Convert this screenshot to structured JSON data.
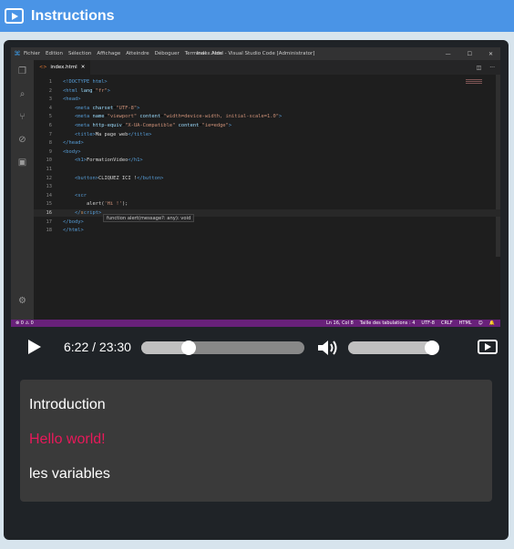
{
  "header": {
    "title": "Instructions",
    "icon": "video-icon"
  },
  "vscode": {
    "menu": [
      "Fichier",
      "Edition",
      "Sélection",
      "Affichage",
      "Atteindre",
      "Déboguer",
      "Terminal",
      "Aide"
    ],
    "window_title": "index.html - Visual Studio Code [Administrator]",
    "tab": "index.html",
    "code": [
      {
        "n": "1",
        "html": "<span class=\"c-tag\">&lt;!DOCTYPE html&gt;</span>"
      },
      {
        "n": "2",
        "html": "<span class=\"c-tag\">&lt;html</span> <span class=\"c-attr\">lang</span>=<span class=\"c-str\">\"fr\"</span><span class=\"c-tag\">&gt;</span>"
      },
      {
        "n": "3",
        "html": "<span class=\"c-tag\">&lt;head&gt;</span>"
      },
      {
        "n": "4",
        "html": "    <span class=\"c-tag\">&lt;meta</span> <span class=\"c-attr\">charset</span>=<span class=\"c-str\">\"UTF-8\"</span><span class=\"c-tag\">&gt;</span>"
      },
      {
        "n": "5",
        "html": "    <span class=\"c-tag\">&lt;meta</span> <span class=\"c-attr\">name</span>=<span class=\"c-str\">\"viewport\"</span> <span class=\"c-attr\">content</span>=<span class=\"c-str\">\"width=device-width, initial-scale=1.0\"</span><span class=\"c-tag\">&gt;</span>"
      },
      {
        "n": "6",
        "html": "    <span class=\"c-tag\">&lt;meta</span> <span class=\"c-attr\">http-equiv</span>=<span class=\"c-str\">\"X-UA-Compatible\"</span> <span class=\"c-attr\">content</span>=<span class=\"c-str\">\"ie=edge\"</span><span class=\"c-tag\">&gt;</span>"
      },
      {
        "n": "7",
        "html": "    <span class=\"c-tag\">&lt;title&gt;</span><span class=\"c-text\">Ma page web</span><span class=\"c-tag\">&lt;/title&gt;</span>"
      },
      {
        "n": "8",
        "html": "<span class=\"c-tag\">&lt;/head&gt;</span>"
      },
      {
        "n": "9",
        "html": "<span class=\"c-tag\">&lt;body&gt;</span>"
      },
      {
        "n": "10",
        "html": "    <span class=\"c-tag\">&lt;h1&gt;</span><span class=\"c-text\">FormationVideo</span><span class=\"c-tag\">&lt;/h1&gt;</span>"
      },
      {
        "n": "11",
        "html": ""
      },
      {
        "n": "12",
        "html": "    <span class=\"c-tag\">&lt;button&gt;</span><span class=\"c-text\">CLIQUEZ ICI !</span><span class=\"c-tag\">&lt;/button&gt;</span>"
      },
      {
        "n": "13",
        "html": ""
      },
      {
        "n": "14",
        "html": "    <span class=\"c-tag\">&lt;scr</span>"
      },
      {
        "n": "15",
        "html": "        <span class=\"c-text\">alert(</span><span class=\"c-str\">'Hi !'</span><span class=\"c-text\">);</span>"
      },
      {
        "n": "16",
        "html": "    <span class=\"c-tag\">&lt;/</span><span class=\"c-tok\">s</span><span class=\"c-tag\">cript&gt;</span>"
      },
      {
        "n": "17",
        "html": "<span class=\"c-tag\">&lt;/body&gt;</span>"
      },
      {
        "n": "18",
        "html": "<span class=\"c-tag\">&lt;/html&gt;</span>"
      }
    ],
    "tooltip": "function alert(message?: any): void",
    "status_left": "⊗ 0 ⚠ 0",
    "status_right": [
      "Ln 16, Col 8",
      "Taille des tabulations : 4",
      "UTF-8",
      "CRLF",
      "HTML",
      "☺",
      "🔔"
    ]
  },
  "player": {
    "time": "6:22 / 23:30",
    "progress_fraction": 0.29,
    "volume_fraction": 0.93
  },
  "chapters": [
    {
      "label": "Introduction",
      "active": false
    },
    {
      "label": "Hello world!",
      "active": true
    },
    {
      "label": "les variables",
      "active": false
    }
  ]
}
